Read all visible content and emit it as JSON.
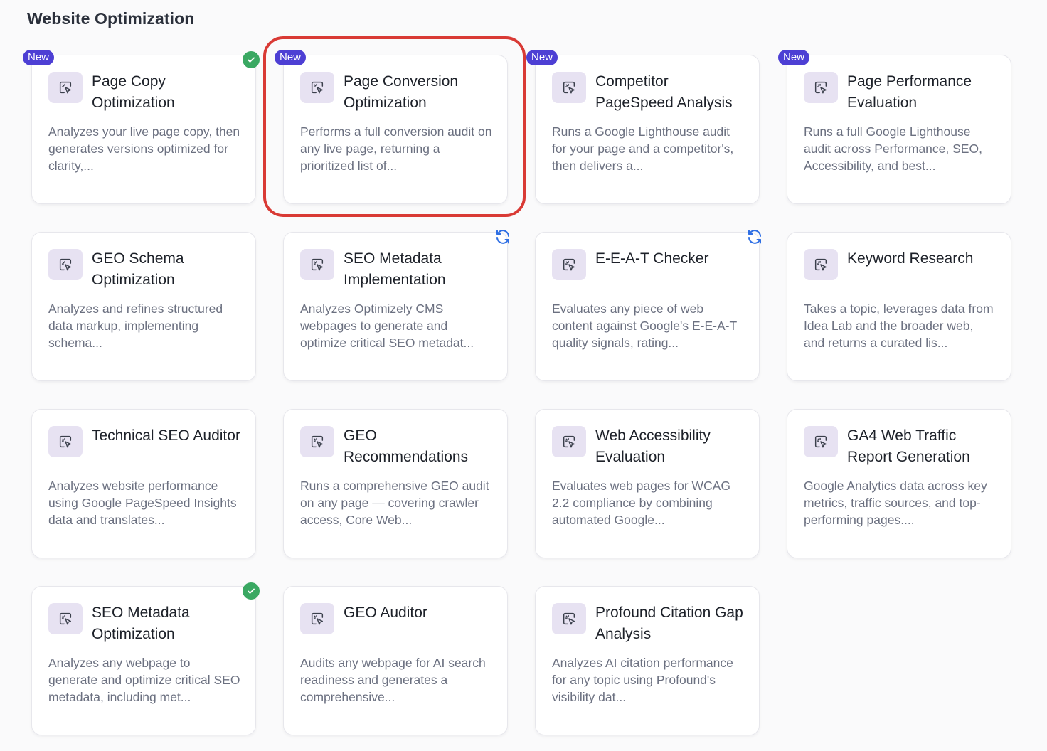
{
  "section": {
    "title": "Website Optimization"
  },
  "colors": {
    "accent_badge": "#4d3fd4",
    "check_green": "#3aa862",
    "sync_blue": "#2f6fe4",
    "highlight_red": "#d93a35",
    "icon_bg": "#e7e2f2"
  },
  "badge_label": "New",
  "cards": [
    {
      "title": "Page Copy Optimization",
      "desc": "Analyzes your live page copy, then generates versions optimized for clarity,...",
      "badge": true,
      "status": "check",
      "highlight": false,
      "icon": "cursor-click-icon"
    },
    {
      "title": "Page Conversion Optimization",
      "desc": "Performs a full conversion audit on any live page, returning a prioritized list of...",
      "badge": true,
      "status": "",
      "highlight": true,
      "icon": "cursor-click-icon"
    },
    {
      "title": "Competitor PageSpeed Analysis",
      "desc": "Runs a Google Lighthouse audit for your page and a competitor's, then delivers a...",
      "badge": true,
      "status": "",
      "highlight": false,
      "icon": "cursor-click-icon"
    },
    {
      "title": "Page Performance Evaluation",
      "desc": "Runs a full Google Lighthouse audit across Performance, SEO, Accessibility, and best...",
      "badge": true,
      "status": "",
      "highlight": false,
      "icon": "cursor-click-icon"
    },
    {
      "title": "GEO Schema Optimization",
      "desc": "Analyzes and refines structured data markup, implementing schema...",
      "badge": false,
      "status": "",
      "highlight": false,
      "icon": "cursor-click-icon"
    },
    {
      "title": "SEO Metadata Implementation",
      "desc": "Analyzes Optimizely CMS webpages to generate and optimize critical SEO metadat...",
      "badge": false,
      "status": "sync",
      "highlight": false,
      "icon": "cursor-click-icon"
    },
    {
      "title": "E-E-A-T Checker",
      "desc": "Evaluates any piece of web content against Google's E-E-A-T quality signals, rating...",
      "badge": false,
      "status": "sync",
      "highlight": false,
      "icon": "cursor-click-icon"
    },
    {
      "title": "Keyword Research",
      "desc": "Takes a topic, leverages data from Idea Lab and the broader web, and returns a curated lis...",
      "badge": false,
      "status": "",
      "highlight": false,
      "icon": "cursor-click-icon"
    },
    {
      "title": "Technical SEO Auditor",
      "desc": "Analyzes website performance using Google PageSpeed Insights data and translates...",
      "badge": false,
      "status": "",
      "highlight": false,
      "icon": "cursor-click-icon"
    },
    {
      "title": "GEO Recommendations",
      "desc": "Runs a comprehensive GEO audit on any page — covering crawler access, Core Web...",
      "badge": false,
      "status": "",
      "highlight": false,
      "icon": "cursor-click-icon"
    },
    {
      "title": "Web Accessibility Evaluation",
      "desc": "Evaluates web pages for WCAG 2.2 compliance by combining automated Google...",
      "badge": false,
      "status": "",
      "highlight": false,
      "icon": "cursor-click-icon"
    },
    {
      "title": "GA4 Web Traffic Report Generation",
      "desc": "Google Analytics data across key metrics, traffic sources, and top-performing pages....",
      "badge": false,
      "status": "",
      "highlight": false,
      "icon": "cursor-click-icon"
    },
    {
      "title": "SEO Metadata Optimization",
      "desc": "Analyzes any webpage to generate and optimize critical SEO metadata, including met...",
      "badge": false,
      "status": "check",
      "highlight": false,
      "icon": "cursor-click-icon"
    },
    {
      "title": "GEO Auditor",
      "desc": "Audits any webpage for AI search readiness and generates a comprehensive...",
      "badge": false,
      "status": "",
      "highlight": false,
      "icon": "cursor-click-icon"
    },
    {
      "title": "Profound Citation Gap Analysis",
      "desc": "Analyzes AI citation performance for any topic using Profound's visibility dat...",
      "badge": false,
      "status": "",
      "highlight": false,
      "icon": "cursor-click-icon"
    }
  ]
}
